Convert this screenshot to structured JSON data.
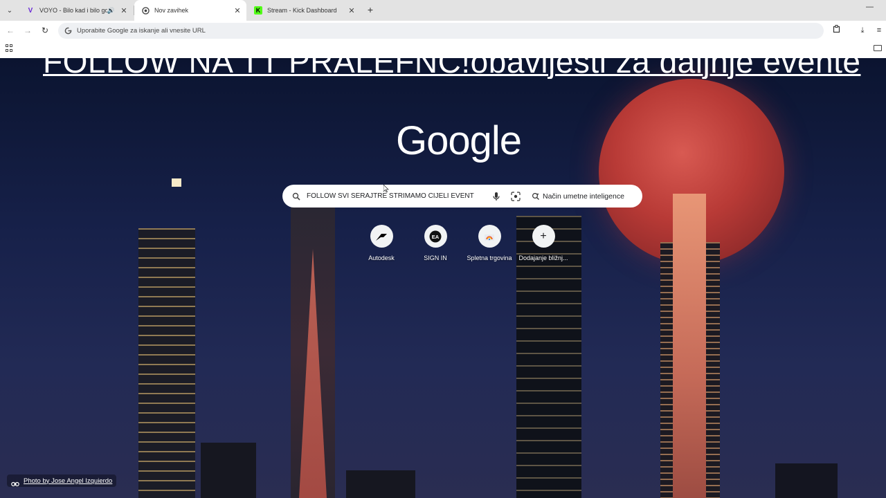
{
  "tabs": [
    {
      "title": "VOYO - Bilo kad i bilo gdje",
      "favicon": "voyo-icon",
      "active": false,
      "audio": true
    },
    {
      "title": "Nov zavihek",
      "favicon": "chrome-icon",
      "active": true,
      "audio": false
    },
    {
      "title": "Stream - Kick Dashboard",
      "favicon": "kick-icon",
      "active": false,
      "audio": false
    }
  ],
  "omnibox": {
    "placeholder": "Uporabite Google za iskanje ali vnesite URL"
  },
  "banner": {
    "text": "FOLLOW NA TT PRALEFNC!obavijesti za daljnje evente"
  },
  "google": {
    "logo": "Google",
    "search_query": "FOLLOW SVI SERAJTRE STRIMAMO CIJELI EVENT",
    "ai_mode_label": "Način umetne inteligence"
  },
  "shortcuts": [
    {
      "label": "Autodesk",
      "icon": "autodesk-icon"
    },
    {
      "label": "SIGN IN",
      "icon": "ea-icon"
    },
    {
      "label": "Spletna trgovina",
      "icon": "web-store-icon"
    },
    {
      "label": "Dodajanje bližnj...",
      "icon": "plus-icon"
    }
  ],
  "attribution": {
    "text": "Photo by Jose Angel Izquierdo"
  },
  "colors": {
    "kick_green": "#53fc18",
    "voyo_purple": "#6a2bd6",
    "moon_red": "#c0413c"
  }
}
